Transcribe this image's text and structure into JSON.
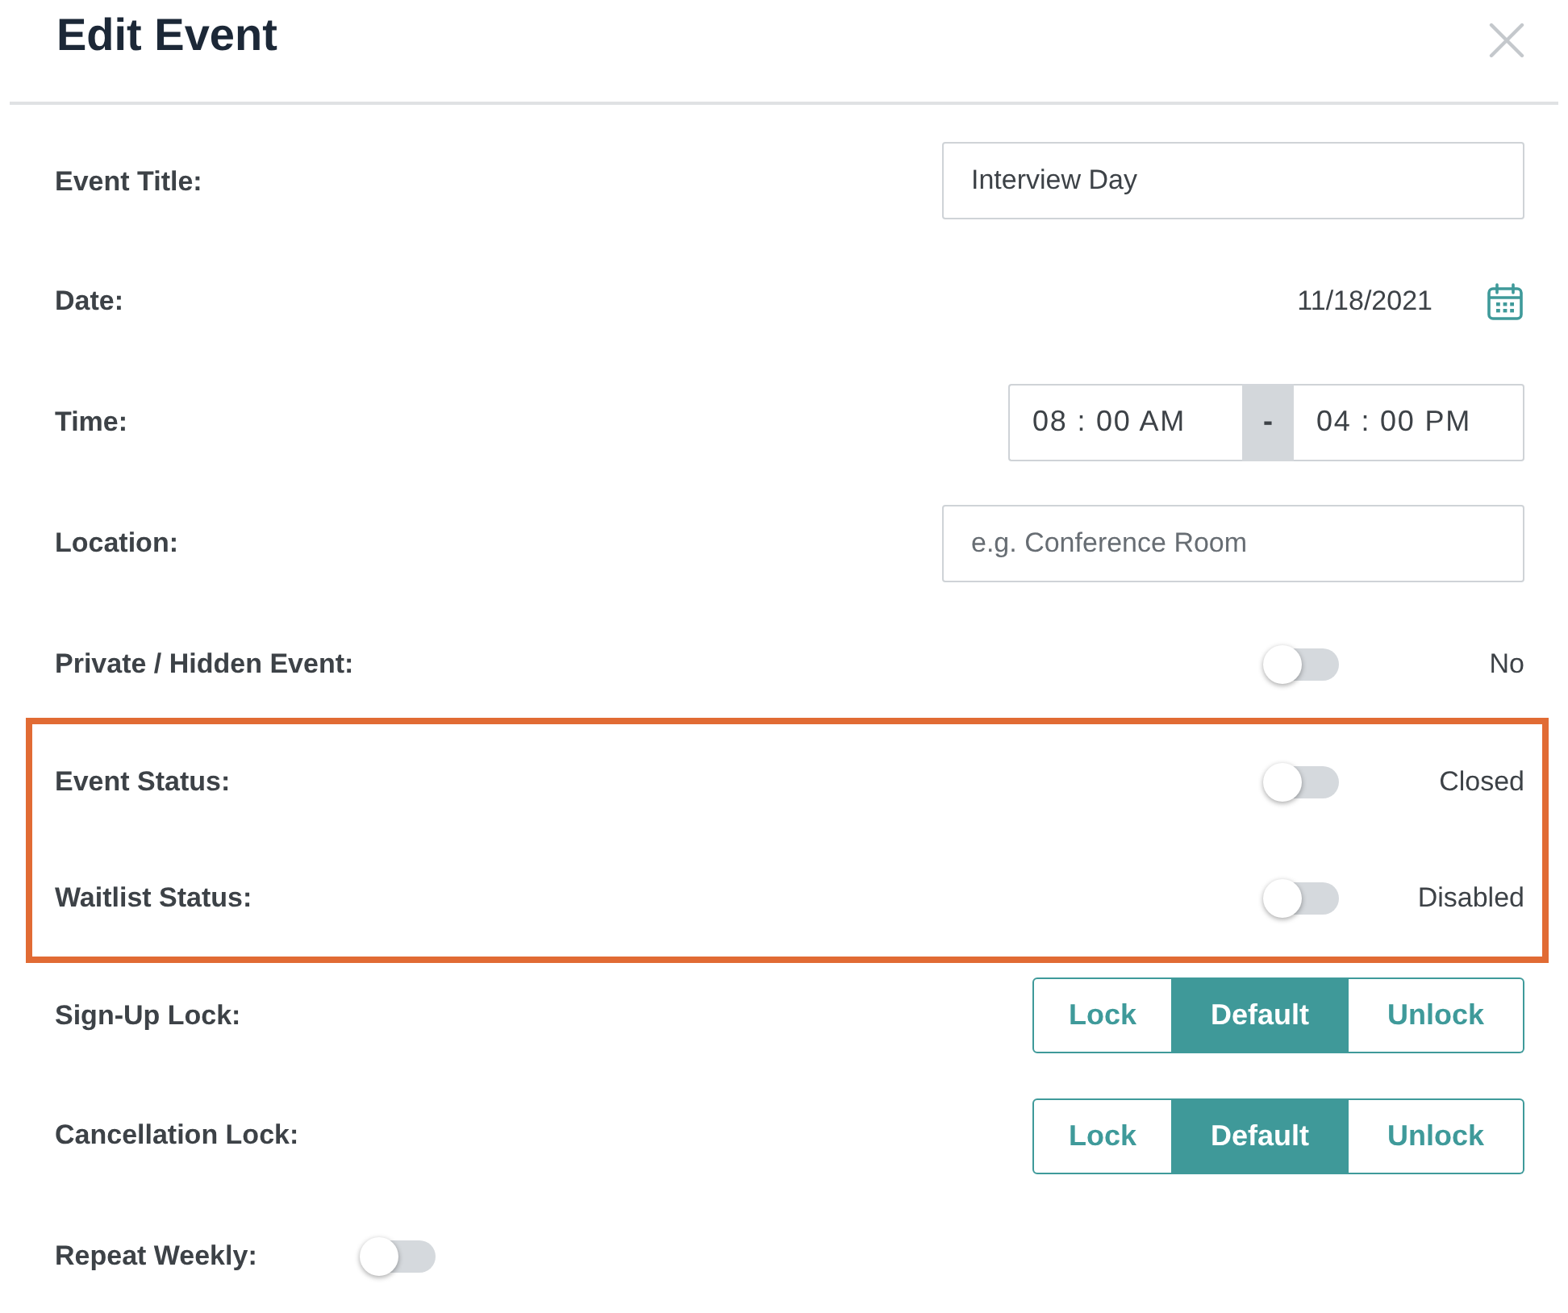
{
  "dialog": {
    "title": "Edit Event"
  },
  "fields": [
    {
      "kind": "text",
      "label": "Event Title:",
      "value": "Interview Day",
      "highlighted": false
    },
    {
      "kind": "date",
      "label": "Date:",
      "value": "11/18/2021",
      "highlighted": false
    },
    {
      "kind": "time_range",
      "label": "Time:",
      "start": "08 : 00 AM",
      "separator": "-",
      "end": "04 : 00 PM",
      "highlighted": false
    },
    {
      "kind": "text",
      "label": "Location:",
      "placeholder": "e.g. Conference Room",
      "highlighted": false
    },
    {
      "kind": "toggle",
      "label": "Private / Hidden Event:",
      "on": false,
      "value": "No",
      "highlighted": false
    },
    {
      "kind": "toggle",
      "label": "Event Status:",
      "on": false,
      "value": "Closed",
      "highlighted": true
    },
    {
      "kind": "toggle",
      "label": "Waitlist Status:",
      "on": false,
      "value": "Disabled",
      "highlighted": true
    },
    {
      "kind": "segmented",
      "label": "Sign-Up Lock:",
      "options": [
        {
          "label": "Lock",
          "selected": false
        },
        {
          "label": "Default",
          "selected": true
        },
        {
          "label": "Unlock",
          "selected": false
        }
      ],
      "highlighted": false
    },
    {
      "kind": "segmented",
      "label": "Cancellation Lock:",
      "options": [
        {
          "label": "Lock",
          "selected": false
        },
        {
          "label": "Default",
          "selected": true
        },
        {
          "label": "Unlock",
          "selected": false
        }
      ],
      "highlighted": false
    },
    {
      "kind": "inline_toggle",
      "label": "Repeat Weekly:",
      "on": false,
      "highlighted": false
    }
  ]
}
